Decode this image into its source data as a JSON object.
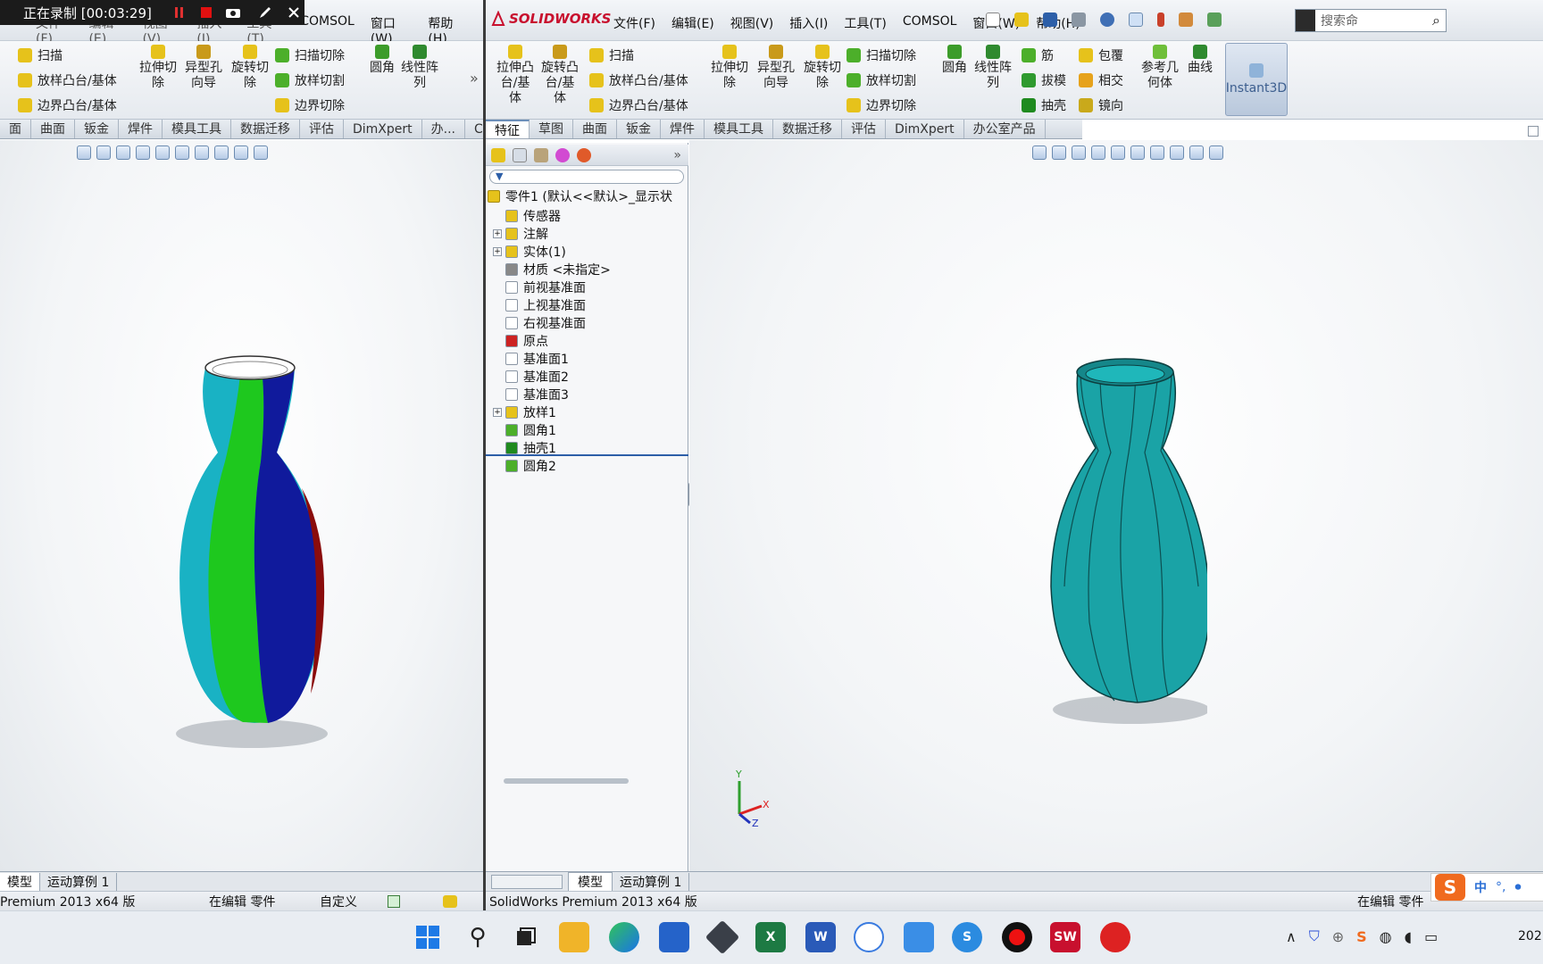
{
  "recording": {
    "label": "正在录制 [00:03:29]"
  },
  "left_window": {
    "menu": [
      "文件(F)",
      "编辑(E)",
      "视图(V)",
      "插入(I)",
      "工具(T)",
      "COMSOL",
      "窗口(W)",
      "帮助(H)"
    ],
    "ribbon": {
      "col1": [
        "扫描",
        "放样凸台/基体",
        "边界凸台/基体"
      ],
      "big": [
        {
          "label": "拉伸切\n除"
        },
        {
          "label": "异型孔\n向导"
        },
        {
          "label": "旋转切\n除"
        }
      ],
      "col2": [
        "扫描切除",
        "放样切割",
        "边界切除"
      ],
      "big2": [
        {
          "label": "圆角"
        },
        {
          "label": "线性阵\n列"
        }
      ]
    },
    "tabs": [
      "面",
      "曲面",
      "钣金",
      "焊件",
      "模具工具",
      "数据迁移",
      "评估",
      "DimXpert",
      "办...",
      "C..."
    ],
    "bottom_tabs": [
      "模型",
      "运动算例 1"
    ],
    "status": {
      "edition": "Premium 2013 x64 版",
      "editing": "在编辑 零件",
      "custom": "自定义"
    }
  },
  "right_window": {
    "logo": "SOLIDWORKS",
    "menu": [
      "文件(F)",
      "编辑(E)",
      "视图(V)",
      "插入(I)",
      "工具(T)",
      "COMSOL",
      "窗口(W)",
      "帮助(H)"
    ],
    "search_placeholder": "搜索命",
    "ribbon": {
      "big1": [
        {
          "label": "拉伸凸\n台/基\n体"
        },
        {
          "label": "旋转凸\n台/基\n体"
        }
      ],
      "col1": [
        "扫描",
        "放样凸台/基体",
        "边界凸台/基体"
      ],
      "big2": [
        {
          "label": "拉伸切\n除"
        },
        {
          "label": "异型孔\n向导"
        },
        {
          "label": "旋转切\n除"
        }
      ],
      "col2": [
        "扫描切除",
        "放样切割",
        "边界切除"
      ],
      "big3": [
        {
          "label": "圆角"
        },
        {
          "label": "线性阵\n列"
        }
      ],
      "col3": [
        "筋",
        "拔模",
        "抽壳"
      ],
      "col4": [
        "包覆",
        "相交",
        "镜向"
      ],
      "big4": [
        {
          "label": "参考几\n何体"
        },
        {
          "label": "曲线"
        }
      ],
      "instant3d": "Instant3D"
    },
    "tabs": [
      "特征",
      "草图",
      "曲面",
      "钣金",
      "焊件",
      "模具工具",
      "数据迁移",
      "评估",
      "DimXpert",
      "办公室产品"
    ],
    "tree": {
      "root": "零件1 (默认<<默认>_显示状",
      "items": [
        {
          "label": "传感器",
          "expand": false
        },
        {
          "label": "注解",
          "expand": true
        },
        {
          "label": "实体(1)",
          "expand": true
        },
        {
          "label": "材质 <未指定>",
          "expand": false
        },
        {
          "label": "前视基准面",
          "expand": false
        },
        {
          "label": "上视基准面",
          "expand": false
        },
        {
          "label": "右视基准面",
          "expand": false
        },
        {
          "label": "原点",
          "expand": false
        },
        {
          "label": "基准面1",
          "expand": false
        },
        {
          "label": "基准面2",
          "expand": false
        },
        {
          "label": "基准面3",
          "expand": false
        },
        {
          "label": "放样1",
          "expand": true
        },
        {
          "label": "圆角1",
          "expand": false
        },
        {
          "label": "抽壳1",
          "expand": false
        },
        {
          "label": "圆角2",
          "expand": false
        }
      ]
    },
    "bottom_tabs": [
      "模型",
      "运动算例 1"
    ],
    "status": {
      "edition": "SolidWorks Premium 2013 x64 版",
      "editing": "在编辑 零件"
    },
    "triad": {
      "x": "X",
      "y": "Y",
      "z": "Z"
    },
    "ime": {
      "lang": "中"
    }
  },
  "taskbar": {
    "clock": "202"
  },
  "colors": {
    "vase_right": "#1aa3a6",
    "vase_cyan": "#19b2c4",
    "vase_green": "#1ec81e",
    "vase_blue": "#101a9c",
    "vase_red": "#8a0c0c",
    "accent": "#c8102e"
  }
}
